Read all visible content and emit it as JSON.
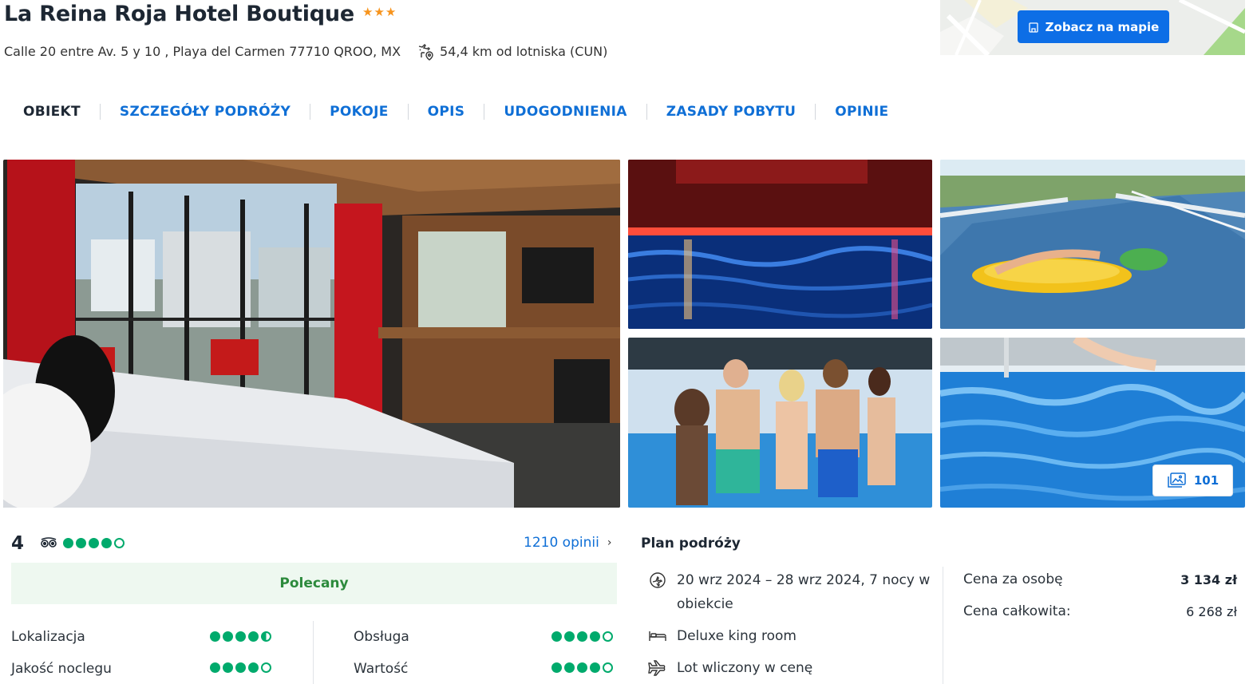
{
  "hotel": {
    "name": "La Reina Roja Hotel Boutique",
    "stars": "★★★",
    "address": "Calle 20 entre Av. 5 y 10 , Playa del Carmen 77710 QROO, MX",
    "airport_distance": "54,4 km od lotniska (CUN)",
    "airport_icon": "airport-distance-icon"
  },
  "map": {
    "button_label": "Zobacz na mapie",
    "icon": "map-building-icon"
  },
  "tabs": [
    {
      "label": "OBIEKT",
      "active": true
    },
    {
      "label": "SZCZEGÓŁY PODRÓŻY",
      "active": false
    },
    {
      "label": "POKOJE",
      "active": false
    },
    {
      "label": "OPIS",
      "active": false
    },
    {
      "label": "UDOGODNIENIA",
      "active": false
    },
    {
      "label": "ZASADY POBYTU",
      "active": false
    },
    {
      "label": "OPINIE",
      "active": false
    }
  ],
  "gallery": {
    "photo_count": "101",
    "photos": [
      "hotel-room-photo",
      "night-pool-photo",
      "rooftop-pool-float-photo",
      "guests-pool-party-photo",
      "pool-water-photo"
    ]
  },
  "rating": {
    "score": "4",
    "bubbles_filled": 4,
    "reviews_link": "1210 opinii",
    "recommendation": "Polecany",
    "subratings": [
      {
        "label": "Lokalizacja",
        "value": 4.5
      },
      {
        "label": "Jakość noclegu",
        "value": 4
      },
      {
        "label": "Obsługa",
        "value": 4
      },
      {
        "label": "Wartość",
        "value": 4
      }
    ]
  },
  "plan": {
    "title": "Plan podróży",
    "dates_line1": "20 wrz 2024 – 28 wrz 2024, 7 nocy w",
    "dates_line2": "obiekcie",
    "room": "Deluxe king room",
    "flight": "Lot wliczony w cenę"
  },
  "price": {
    "per_person_label": "Cena za osobę",
    "per_person_value": "3 134 zł",
    "total_label": "Cena całkowita:",
    "total_value": "6 268 zł"
  },
  "colors": {
    "accent": "#0d6ee6",
    "link": "#0f6fd6",
    "star": "#f7941d",
    "tripadvisor": "#00aa6c",
    "recommended_bg": "#eef8f0",
    "recommended_text": "#2c8a3c"
  }
}
